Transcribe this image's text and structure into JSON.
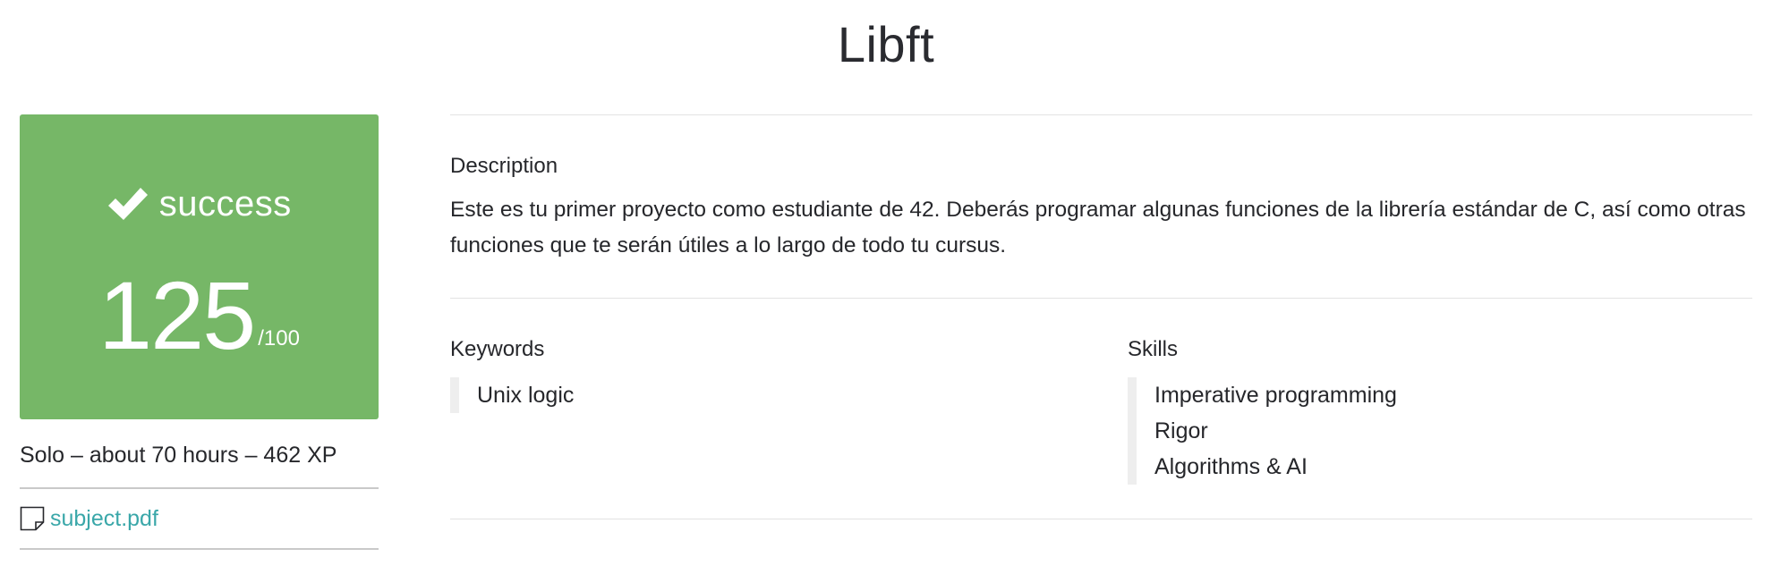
{
  "project": {
    "title": "Libft"
  },
  "result": {
    "status": "success",
    "mark": "125",
    "max_mark": "/100",
    "color": "#76b767",
    "icon": "check-icon"
  },
  "meta": {
    "info": "Solo – about 70 hours – 462 XP"
  },
  "attachment": {
    "label": "subject.pdf",
    "icon": "file-icon",
    "link_color": "#3aa7a9"
  },
  "description": {
    "label": "Description",
    "text": "Este es tu primer proyecto como estudiante de 42. Deberás programar algunas funciones de la librería estándar de C, así como otras funciones que te serán útiles a lo largo de todo tu cursus."
  },
  "keywords": {
    "label": "Keywords",
    "items": [
      "Unix logic"
    ]
  },
  "skills": {
    "label": "Skills",
    "items": [
      "Imperative programming",
      "Rigor",
      "Algorithms & AI"
    ]
  }
}
